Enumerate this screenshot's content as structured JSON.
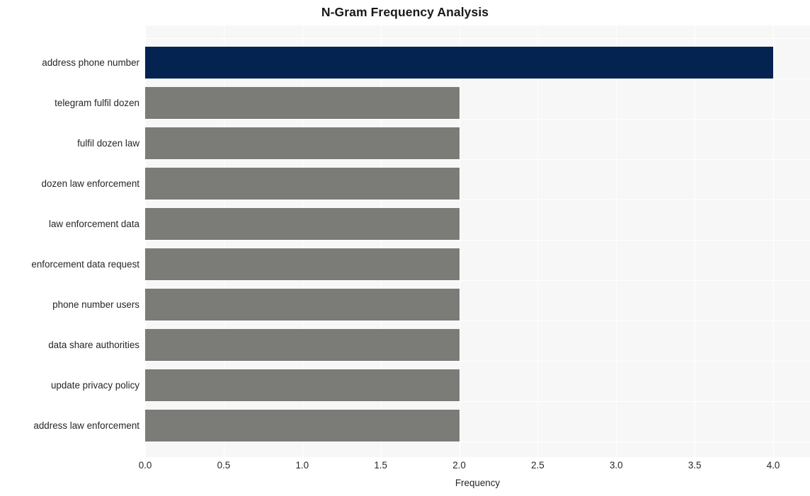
{
  "chart_data": {
    "type": "bar",
    "orientation": "horizontal",
    "title": "N-Gram Frequency Analysis",
    "xlabel": "Frequency",
    "ylabel": "",
    "xlim": [
      0.0,
      4.0
    ],
    "xticks": [
      "0.0",
      "0.5",
      "1.0",
      "1.5",
      "2.0",
      "2.5",
      "3.0",
      "3.5",
      "4.0"
    ],
    "xtick_values": [
      0.0,
      0.5,
      1.0,
      1.5,
      2.0,
      2.5,
      3.0,
      3.5,
      4.0
    ],
    "grid": "vertical-white-on-gray",
    "legend": "none",
    "categories": [
      "address phone number",
      "telegram fulfil dozen",
      "fulfil dozen law",
      "dozen law enforcement",
      "law enforcement data",
      "enforcement data request",
      "phone number users",
      "data share authorities",
      "update privacy policy",
      "address law enforcement"
    ],
    "values": [
      4,
      2,
      2,
      2,
      2,
      2,
      2,
      2,
      2,
      2
    ],
    "bar_colors": [
      "#042351",
      "#7b7b78",
      "#7b7b78",
      "#7b7b78",
      "#7b7b78",
      "#7b7b78",
      "#7b7b78",
      "#7b7b78",
      "#7b7b78",
      "#7b7b78"
    ]
  },
  "style": {
    "highlight_color": "#042351",
    "default_bar_color": "#7b7b78",
    "plot_background": "#f7f7f7",
    "gridline_color": "#ffffff",
    "page_background": "#ffffff",
    "text_color": "#262626",
    "title_color": "#181818"
  }
}
